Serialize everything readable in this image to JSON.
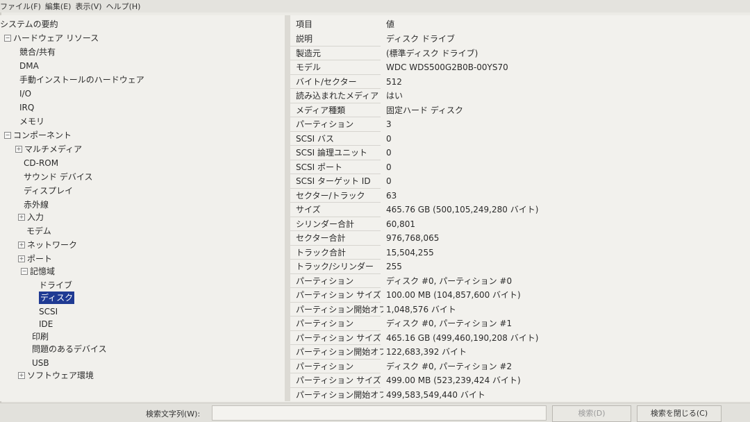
{
  "menubar": {
    "items": [
      "ファイル(F)",
      "編集(E)",
      "表示(V)",
      "ヘルプ(H)"
    ]
  },
  "tree": {
    "items": [
      {
        "label": "システムの要約",
        "toggle": ""
      },
      {
        "label": "ハードウェア リソース",
        "toggle": "-"
      },
      {
        "label": "競合/共有",
        "toggle": ""
      },
      {
        "label": "DMA",
        "toggle": ""
      },
      {
        "label": "手動インストールのハードウェア",
        "toggle": ""
      },
      {
        "label": "I/O",
        "toggle": ""
      },
      {
        "label": "IRQ",
        "toggle": ""
      },
      {
        "label": "メモリ",
        "toggle": ""
      },
      {
        "label": "コンポーネント",
        "toggle": "-"
      },
      {
        "label": "マルチメディア",
        "toggle": "+"
      },
      {
        "label": "CD-ROM",
        "toggle": ""
      },
      {
        "label": "サウンド デバイス",
        "toggle": ""
      },
      {
        "label": "ディスプレイ",
        "toggle": ""
      },
      {
        "label": "赤外線",
        "toggle": ""
      },
      {
        "label": "入力",
        "toggle": "+"
      },
      {
        "label": "モデム",
        "toggle": ""
      },
      {
        "label": "ネットワーク",
        "toggle": "+"
      },
      {
        "label": "ポート",
        "toggle": "+"
      },
      {
        "label": "記憶域",
        "toggle": "-"
      },
      {
        "label": "ドライブ",
        "toggle": ""
      },
      {
        "label": "ディスク",
        "toggle": "",
        "selected": true
      },
      {
        "label": "SCSI",
        "toggle": ""
      },
      {
        "label": "IDE",
        "toggle": ""
      },
      {
        "label": "印刷",
        "toggle": ""
      },
      {
        "label": "問題のあるデバイス",
        "toggle": ""
      },
      {
        "label": "USB",
        "toggle": ""
      },
      {
        "label": "ソフトウェア環境",
        "toggle": "+"
      }
    ]
  },
  "detail": {
    "header": {
      "item": "項目",
      "value": "値"
    },
    "rows": [
      {
        "item": "説明",
        "value": "ディスク ドライブ"
      },
      {
        "item": "製造元",
        "value": "(標準ディスク ドライブ)"
      },
      {
        "item": "モデル",
        "value": "WDC WDS500G2B0B-00YS70"
      },
      {
        "item": "バイト/セクター",
        "value": "512"
      },
      {
        "item": "読み込まれたメディア",
        "value": "はい"
      },
      {
        "item": "メディア種類",
        "value": "固定ハード ディスク"
      },
      {
        "item": "パーティション",
        "value": "3"
      },
      {
        "item": "SCSI バス",
        "value": "0"
      },
      {
        "item": "SCSI 論理ユニット",
        "value": "0"
      },
      {
        "item": "SCSI ポート",
        "value": "0"
      },
      {
        "item": "SCSI ターゲット ID",
        "value": "0"
      },
      {
        "item": "セクター/トラック",
        "value": "63"
      },
      {
        "item": "サイズ",
        "value": "465.76 GB (500,105,249,280 バイト)"
      },
      {
        "item": "シリンダー合計",
        "value": "60,801"
      },
      {
        "item": "セクター合計",
        "value": "976,768,065"
      },
      {
        "item": "トラック合計",
        "value": "15,504,255"
      },
      {
        "item": "トラック/シリンダー",
        "value": "255"
      },
      {
        "item": "パーティション",
        "value": "ディスク #0, パーティション #0"
      },
      {
        "item": "パーティション サイズ",
        "value": "100.00 MB (104,857,600 バイト)"
      },
      {
        "item": "パーティション開始オフ...",
        "value": "1,048,576 バイト"
      },
      {
        "item": "パーティション",
        "value": "ディスク #0, パーティション #1"
      },
      {
        "item": "パーティション サイズ",
        "value": "465.16 GB (499,460,190,208 バイト)"
      },
      {
        "item": "パーティション開始オフ...",
        "value": "122,683,392 バイト"
      },
      {
        "item": "パーティション",
        "value": "ディスク #0, パーティション #2"
      },
      {
        "item": "パーティション サイズ",
        "value": "499.00 MB (523,239,424 バイト)"
      },
      {
        "item": "パーティション開始オフ...",
        "value": "499,583,549,440 バイト"
      }
    ]
  },
  "search": {
    "label": "検索文字列(W):",
    "value": "",
    "search_button": "検索(D)",
    "close_button": "検索を閉じる(C)"
  }
}
